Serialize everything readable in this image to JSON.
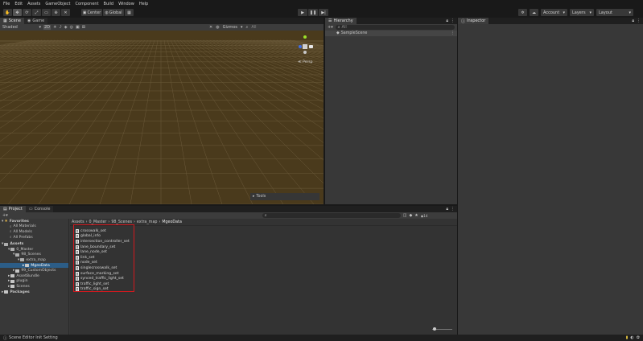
{
  "menu": [
    "File",
    "Edit",
    "Assets",
    "GameObject",
    "Component",
    "Build",
    "Window",
    "Help"
  ],
  "toolbar": {
    "pivot_center": "Center",
    "global": "Global",
    "account": "Account",
    "layers": "Layers",
    "layout": "Layout"
  },
  "scene": {
    "tabs": [
      "Scene",
      "Game"
    ],
    "shading": "Shaded",
    "mode_2d": "2D",
    "gizmos": "Gizmos",
    "search_hint": "All",
    "persp": "Persp",
    "tools_overlay": "Tools"
  },
  "hierarchy": {
    "tab": "Hierarchy",
    "search_hint": "All",
    "root": "SampleScene"
  },
  "inspector": {
    "tab": "Inspector"
  },
  "project": {
    "tabs": [
      "Project",
      "Console"
    ],
    "favorites_header": "Favorites",
    "favorites": [
      "All Materials",
      "All Models",
      "All Prefabs"
    ],
    "assets_header": "Assets",
    "tree": [
      {
        "label": "0_Master",
        "indent": 1,
        "open": true
      },
      {
        "label": "98_Scenes",
        "indent": 2,
        "open": true
      },
      {
        "label": "extra_map",
        "indent": 3,
        "open": true
      },
      {
        "label": "MgeoData",
        "indent": 4,
        "open": false,
        "selected": true
      },
      {
        "label": "99_CustomObjects",
        "indent": 2,
        "open": false
      },
      {
        "label": "AssetBundle",
        "indent": 1,
        "open": false
      },
      {
        "label": "plugin",
        "indent": 1,
        "open": false
      },
      {
        "label": "Scenes",
        "indent": 1,
        "open": false
      }
    ],
    "packages_header": "Packages",
    "breadcrumb": [
      "Assets",
      "0_Master",
      "98_Scenes",
      "extra_map",
      "MgeoData"
    ],
    "files": [
      "crosswalk_set",
      "global_info",
      "intersection_controller_set",
      "lane_boundary_set",
      "lane_node_set",
      "link_set",
      "node_set",
      "singlecrosswalk_set",
      "surface_marking_set",
      "synced_traffic_light_set",
      "traffic_light_set",
      "traffic_sign_set"
    ],
    "file_count_badge": "14"
  },
  "status": {
    "message": "Scene Editor Init Setting"
  },
  "colors": {
    "highlight": "#d4191e",
    "selection": "#2c5d87",
    "scene_ground": "#4a3a1c"
  }
}
